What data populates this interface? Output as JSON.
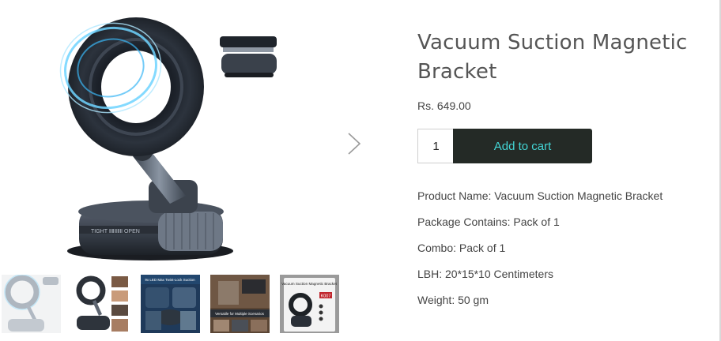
{
  "product": {
    "title": "Vacuum Suction Magnetic Bracket",
    "price": "Rs. 649.00"
  },
  "cart": {
    "quantity": "1",
    "add_label": "Add to cart"
  },
  "details": [
    "Product Name: Vacuum Suction Magnetic Bracket",
    "Package Contains: Pack of 1",
    "Combo: Pack of 1",
    "LBH: 20*15*10 Centimeters",
    "Weight: 50 gm"
  ],
  "thumbnails": {
    "3_text_top": "9x LED Max Twist-Lock Suction",
    "4_text_bottom": "Versatile for Multiple Scenarios",
    "5_text_top": "Vacuum Suction Magnetic Bracket",
    "5_badge": "K007"
  },
  "colors": {
    "button_bg": "#242a26",
    "button_text": "#43d6d6"
  },
  "icons": {
    "next": "chevron-right-icon"
  }
}
